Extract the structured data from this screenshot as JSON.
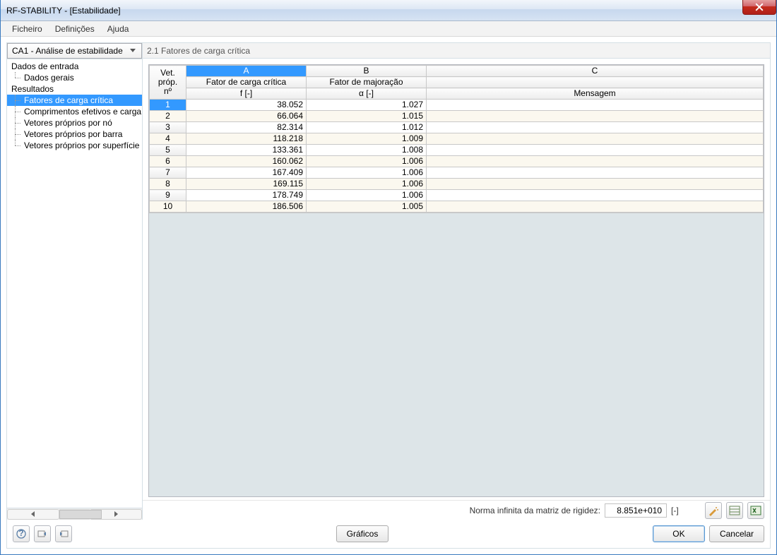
{
  "window": {
    "title": "RF-STABILITY - [Estabilidade]"
  },
  "menu": {
    "items": [
      "Ficheiro",
      "Definições",
      "Ajuda"
    ]
  },
  "sidebar": {
    "combo": "CA1 - Análise de estabilidade",
    "nodes": {
      "input_data": "Dados de entrada",
      "general": "Dados gerais",
      "results": "Resultados",
      "r1": "Fatores de carga crítica",
      "r2": "Comprimentos efetivos e carga",
      "r3": "Vetores próprios por nó",
      "r4": "Vetores próprios por barra",
      "r5": "Vetores próprios por superfície"
    }
  },
  "section": {
    "title": "2.1 Fatores de carga crítica"
  },
  "grid": {
    "corner1": "Vet. próp.",
    "corner2": "nº",
    "cols": {
      "A": "A",
      "B": "B",
      "C": "C",
      "A_label": "Fator de carga crítica",
      "A_sub": "f [-]",
      "B_label": "Fator de majoração",
      "B_sub": "α [-]",
      "C_label": "",
      "C_sub": "Mensagem"
    },
    "rows": [
      {
        "n": "1",
        "f": "38.052",
        "a": "1.027",
        "m": ""
      },
      {
        "n": "2",
        "f": "66.064",
        "a": "1.015",
        "m": ""
      },
      {
        "n": "3",
        "f": "82.314",
        "a": "1.012",
        "m": ""
      },
      {
        "n": "4",
        "f": "118.218",
        "a": "1.009",
        "m": ""
      },
      {
        "n": "5",
        "f": "133.361",
        "a": "1.008",
        "m": ""
      },
      {
        "n": "6",
        "f": "160.062",
        "a": "1.006",
        "m": ""
      },
      {
        "n": "7",
        "f": "167.409",
        "a": "1.006",
        "m": ""
      },
      {
        "n": "8",
        "f": "169.115",
        "a": "1.006",
        "m": ""
      },
      {
        "n": "9",
        "f": "178.749",
        "a": "1.006",
        "m": ""
      },
      {
        "n": "10",
        "f": "186.506",
        "a": "1.005",
        "m": ""
      }
    ]
  },
  "status": {
    "label": "Norma infinita da matriz de rigidez:",
    "value": "8.851e+010",
    "unit": "[-]"
  },
  "buttons": {
    "graphics": "Gráficos",
    "ok": "OK",
    "cancel": "Cancelar"
  }
}
